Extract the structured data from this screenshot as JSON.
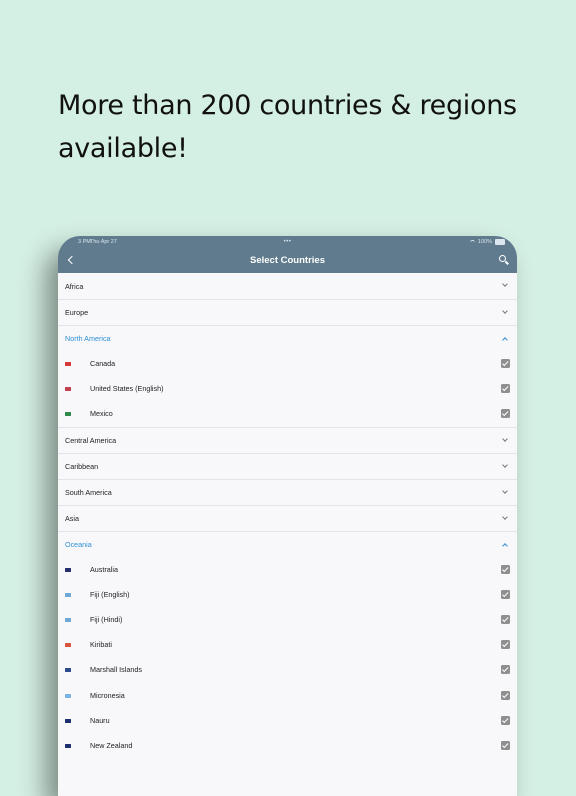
{
  "headline": "More than 200 countries & regions available!",
  "status_bar": {
    "time": "3 PM",
    "date": "Thu Apr 27",
    "dots": "•••",
    "battery": "100%"
  },
  "nav": {
    "title": "Select Countries",
    "back_icon": "chevron-left-icon",
    "search_icon": "search-icon"
  },
  "colors": {
    "background": "#d4efe3",
    "nav_bar": "#5f7b8d",
    "accent": "#2e8fd8",
    "checkbox": "#8f8f8f"
  },
  "regions": {
    "africa": "Africa",
    "europe": "Europe",
    "north_america": {
      "label": "North America",
      "countries": [
        {
          "name": "Canada",
          "checked": true,
          "flag_color": "#d8373a"
        },
        {
          "name": "United States (English)",
          "checked": true,
          "flag_color": "#c2414f"
        },
        {
          "name": "Mexico",
          "checked": true,
          "flag_color": "#2f8a4a"
        }
      ]
    },
    "central_america": "Central America",
    "caribbean": "Caribbean",
    "south_america": "South America",
    "asia": "Asia",
    "oceania": {
      "label": "Oceania",
      "countries": [
        {
          "name": "Australia",
          "checked": true,
          "flag_color": "#26306b"
        },
        {
          "name": "Fiji (English)",
          "checked": true,
          "flag_color": "#6fa7d6"
        },
        {
          "name": "Fiji (Hindi)",
          "checked": true,
          "flag_color": "#6fa7d6"
        },
        {
          "name": "Kiribati",
          "checked": true,
          "flag_color": "#d9543f"
        },
        {
          "name": "Marshall Islands",
          "checked": true,
          "flag_color": "#2d4a8a"
        },
        {
          "name": "Micronesia",
          "checked": true,
          "flag_color": "#7ab4e0"
        },
        {
          "name": "Nauru",
          "checked": true,
          "flag_color": "#1d2f6e"
        },
        {
          "name": "New Zealand",
          "checked": true,
          "flag_color": "#1d2f6e"
        }
      ]
    }
  }
}
